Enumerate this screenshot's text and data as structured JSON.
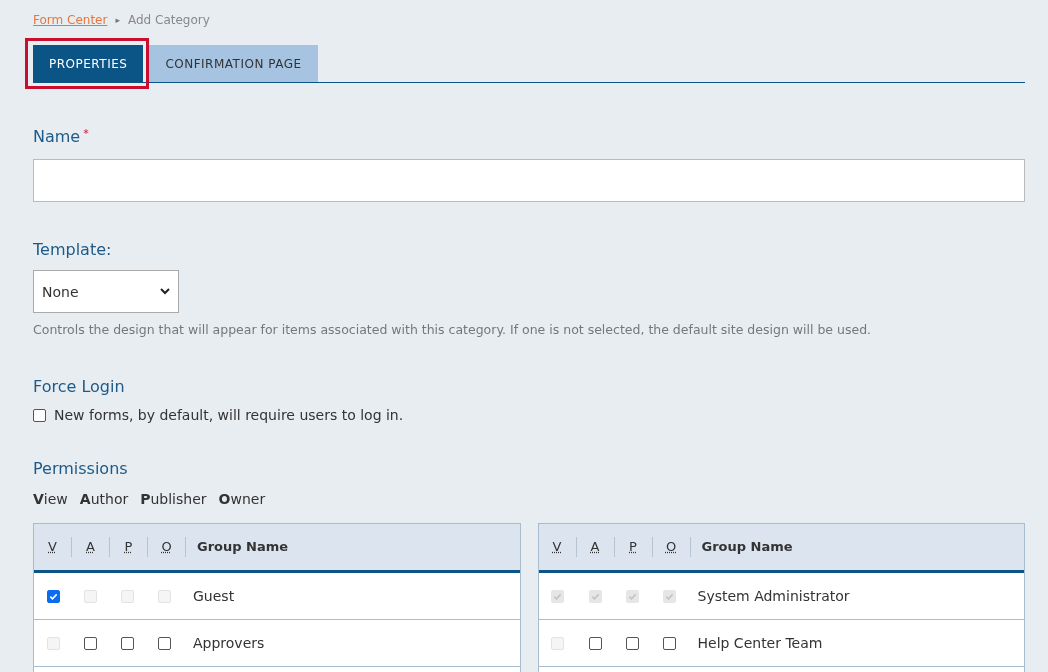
{
  "breadcrumb": {
    "link": "Form Center",
    "separator": "▸",
    "current": "Add Category"
  },
  "tabs": [
    {
      "label": "PROPERTIES",
      "selected": true,
      "highlighted": true
    },
    {
      "label": "CONFIRMATION PAGE",
      "selected": false,
      "highlighted": false
    }
  ],
  "name_field": {
    "label": "Name",
    "required_mark": "*"
  },
  "template": {
    "label": "Template:",
    "value": "None",
    "help": "Controls the design that will appear for items associated with this category. If one is not selected, the default site design will be used."
  },
  "force_login": {
    "label": "Force Login",
    "checkbox_label": "New forms, by default, will require users to log in.",
    "checked": false
  },
  "permissions": {
    "label": "Permissions",
    "legend": [
      "**V**iew",
      "**A**uthor",
      "**P**ublisher",
      "**O**wner"
    ],
    "tables": [
      {
        "columns": [
          "V",
          "A",
          "P",
          "O",
          "Group Name"
        ],
        "rows": [
          {
            "group": "Guest",
            "permissions": [
              {
                "checked": true,
                "disabled": false
              },
              {
                "checked": false,
                "disabled": true
              },
              {
                "checked": false,
                "disabled": true
              },
              {
                "checked": false,
                "disabled": true
              }
            ]
          },
          {
            "group": "Approvers",
            "permissions": [
              {
                "checked": false,
                "disabled": true
              },
              {
                "checked": false,
                "disabled": false
              },
              {
                "checked": false,
                "disabled": false
              },
              {
                "checked": false,
                "disabled": false
              }
            ]
          }
        ]
      },
      {
        "columns": [
          "V",
          "A",
          "P",
          "O",
          "Group Name"
        ],
        "rows": [
          {
            "group": "System Administrator",
            "permissions": [
              {
                "checked": true,
                "disabled": true
              },
              {
                "checked": true,
                "disabled": true
              },
              {
                "checked": true,
                "disabled": true
              },
              {
                "checked": true,
                "disabled": true
              }
            ]
          },
          {
            "group": "Help Center Team",
            "permissions": [
              {
                "checked": false,
                "disabled": true
              },
              {
                "checked": false,
                "disabled": false
              },
              {
                "checked": false,
                "disabled": false
              },
              {
                "checked": false,
                "disabled": false
              }
            ]
          }
        ]
      }
    ]
  }
}
